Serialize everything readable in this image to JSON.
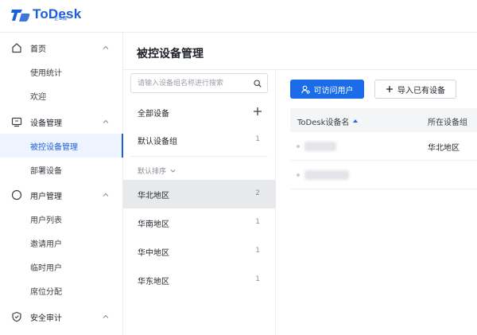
{
  "app": {
    "brand": "ToDesk",
    "edition": "企业版"
  },
  "sidebar": {
    "groups": [
      {
        "label": "首页",
        "icon": "home-icon",
        "items": [
          "使用统计",
          "欢迎"
        ]
      },
      {
        "label": "设备管理",
        "icon": "monitor-icon",
        "items": [
          "被控设备管理",
          "部署设备"
        ]
      },
      {
        "label": "用户管理",
        "icon": "user-icon",
        "items": [
          "用户列表",
          "邀请用户",
          "临时用户",
          "席位分配"
        ]
      },
      {
        "label": "安全审计",
        "icon": "shield-icon",
        "items": []
      }
    ],
    "active_item": "被控设备管理"
  },
  "page": {
    "title": "被控设备管理"
  },
  "group_panel": {
    "search_placeholder": "请输入设备组名称进行搜索",
    "all_devices": "全部设备",
    "default_group": {
      "label": "默认设备组",
      "count": "1"
    },
    "sort_label": "默认排序",
    "regions": [
      {
        "label": "华北地区",
        "count": "2",
        "selected": true
      },
      {
        "label": "华南地区",
        "count": "1",
        "selected": false
      },
      {
        "label": "华中地区",
        "count": "1",
        "selected": false
      },
      {
        "label": "华东地区",
        "count": "1",
        "selected": false
      }
    ]
  },
  "toolbar": {
    "visit_users_label": "可访问用户",
    "import_label": "导入已有设备"
  },
  "table": {
    "columns": [
      "ToDesk设备名",
      "所在设备组"
    ],
    "rows": [
      {
        "group": "华北地区"
      },
      {
        "group": ""
      }
    ]
  },
  "colors": {
    "accent": "#1b6ce8",
    "brand": "#1b5fd6",
    "selected_bg": "#e8e9ec"
  }
}
